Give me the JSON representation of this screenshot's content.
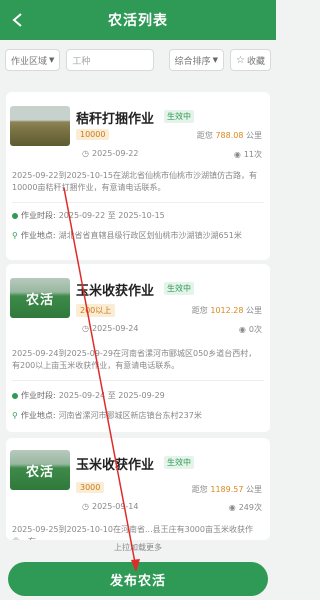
{
  "header": {
    "title": "农活列表"
  },
  "filters": {
    "region_label": "作业区域",
    "search_placeholder": "工种",
    "sort_label": "综合排序",
    "favorite_label": "收藏"
  },
  "cards": [
    {
      "title": "秸秆打捆作业",
      "status": "生效中",
      "price": "10000",
      "distance_prefix": "距您",
      "distance": "788.08",
      "distance_unit": "公里",
      "date": "2025-09-22",
      "views": "11次",
      "description": "2025-09-22到2025-10-15在湖北省仙桃市仙桃市沙湖镇仿古路，有10000亩秸秆打捆作业，有意请电话联系。",
      "period_label": "作业时段:",
      "period": "2025-09-22 至 2025-10-15",
      "location_label": "作业地点:",
      "location": "湖北省省直辖县级行政区划仙桃市沙湖镇沙湖651米"
    },
    {
      "title": "玉米收获作业",
      "status": "生效中",
      "price": "200以上",
      "thumb_text": "农活",
      "distance_prefix": "距您",
      "distance": "1012.28",
      "distance_unit": "公里",
      "date": "2025-09-24",
      "views": "0次",
      "description": "2025-09-24到2025-09-29在河南省漯河市郾城区050乡道台西村，有200以上亩玉米收获作业，有意请电话联系。",
      "period_label": "作业时段:",
      "period": "2025-09-24 至 2025-09-29",
      "location_label": "作业地点:",
      "location": "河南省漯河市郾城区新店镇台东村237米"
    },
    {
      "title": "玉米收获作业",
      "status": "生效中",
      "price": "3000",
      "thumb_text": "农活",
      "distance_prefix": "距您",
      "distance": "1189.57",
      "distance_unit": "公里",
      "date": "2025-09-14",
      "views": "249次",
      "description": "2025-09-25到2025-10-10在河南省...县王庄有3000亩玉米收获作业，有"
    }
  ],
  "footer": {
    "load_more": "上拉加载更多",
    "publish_label": "发布农活"
  },
  "colors": {
    "brand": "#2f9a55",
    "price": "#c97b1a",
    "distance": "#d9891f"
  }
}
